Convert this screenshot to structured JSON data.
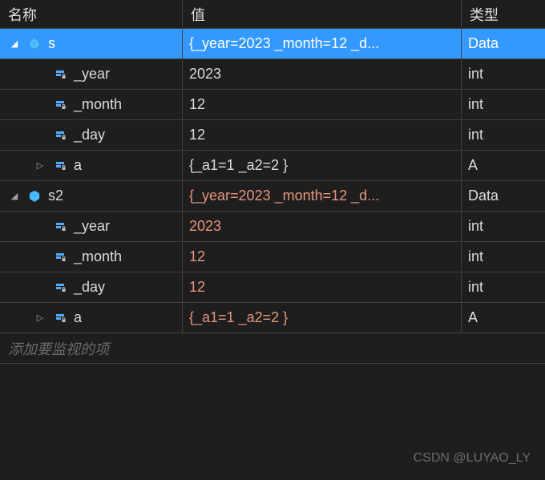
{
  "headers": {
    "name": "名称",
    "value": "值",
    "type": "类型"
  },
  "rows": [
    {
      "depth": 0,
      "expander": "expanded",
      "icon": "cube-blue",
      "name": "s",
      "value": "{_year=2023 _month=12 _d...",
      "type": "Data",
      "changed": false,
      "selected": true
    },
    {
      "depth": 1,
      "expander": "none",
      "icon": "field-lock",
      "name": "_year",
      "value": "2023",
      "type": "int",
      "changed": false
    },
    {
      "depth": 1,
      "expander": "none",
      "icon": "field-lock",
      "name": "_month",
      "value": "12",
      "type": "int",
      "changed": false
    },
    {
      "depth": 1,
      "expander": "none",
      "icon": "field-lock",
      "name": "_day",
      "value": "12",
      "type": "int",
      "changed": false
    },
    {
      "depth": 1,
      "expander": "collapsed",
      "icon": "field-lock",
      "name": "a",
      "value": "{_a1=1 _a2=2 }",
      "type": "A",
      "changed": false
    },
    {
      "depth": 0,
      "expander": "expanded",
      "icon": "cube-blue",
      "name": "s2",
      "value": "{_year=2023 _month=12 _d...",
      "type": "Data",
      "changed": true
    },
    {
      "depth": 1,
      "expander": "none",
      "icon": "field-lock",
      "name": "_year",
      "value": "2023",
      "type": "int",
      "changed": true
    },
    {
      "depth": 1,
      "expander": "none",
      "icon": "field-lock",
      "name": "_month",
      "value": "12",
      "type": "int",
      "changed": true
    },
    {
      "depth": 1,
      "expander": "none",
      "icon": "field-lock",
      "name": "_day",
      "value": "12",
      "type": "int",
      "changed": true
    },
    {
      "depth": 1,
      "expander": "collapsed",
      "icon": "field-lock",
      "name": "a",
      "value": "{_a1=1 _a2=2 }",
      "type": "A",
      "changed": true
    }
  ],
  "placeholder": "添加要监视的项",
  "watermark": "CSDN @LUYAO_LY",
  "icons": {
    "expanded": "◢",
    "collapsed": "▷"
  }
}
